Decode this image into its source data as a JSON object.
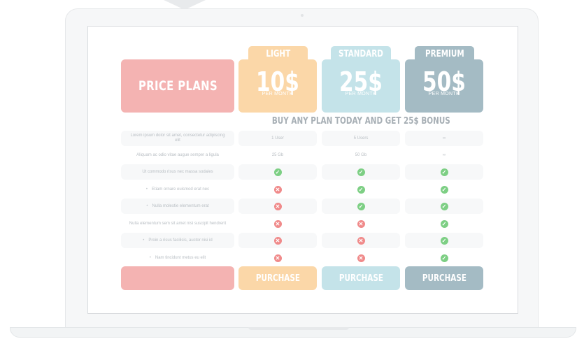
{
  "header": {
    "title": "PRICE PLANS"
  },
  "plans": [
    {
      "name": "LIGHT",
      "price": "10$",
      "period": "PER MONTH",
      "button": "PURCHASE"
    },
    {
      "name": "STANDARD",
      "price": "25$",
      "period": "PER MONTH",
      "button": "PURCHASE"
    },
    {
      "name": "PREMIUM",
      "price": "50$",
      "period": "PER MONTH",
      "button": "PURCHASE"
    }
  ],
  "bonus": "BUY ANY PLAN TODAY AND GET 25$ BONUS",
  "features": [
    {
      "label": "Lorem ipsum dolor sit amet, consectetur adipiscing elit",
      "values": [
        "1 User",
        "5 Users",
        "∞"
      ]
    },
    {
      "label": "Aliquam ac odio vitae augue semper a ligula",
      "values": [
        "25 Gb",
        "50 Gb",
        "∞"
      ]
    },
    {
      "label": "Ut commodo risus nec massa sodales",
      "values": [
        "yes",
        "yes",
        "yes"
      ]
    },
    {
      "label": "Etiam ornare euismod erat nec",
      "values": [
        "no",
        "yes",
        "yes"
      ]
    },
    {
      "label": "Nulla molestie elementum erat",
      "values": [
        "no",
        "yes",
        "yes"
      ]
    },
    {
      "label": "Nulla elementum sem sit amet nisi suscipit hendrerit",
      "values": [
        "no",
        "no",
        "yes"
      ]
    },
    {
      "label": "Proin a risus facilisis, auctor nisi id",
      "values": [
        "no",
        "no",
        "yes"
      ]
    },
    {
      "label": "Nam tincidunt metus eu elit",
      "values": [
        "no",
        "no",
        "yes"
      ]
    }
  ],
  "icons": {
    "yes": "check-circle-icon",
    "no": "cross-circle-icon"
  },
  "colors": {
    "title": "#f4b3b2",
    "light": "#fbd7a8",
    "standard": "#c4e3e9",
    "premium": "#a4bbc4",
    "check": "#7dcf84",
    "cross": "#f08a8a"
  }
}
